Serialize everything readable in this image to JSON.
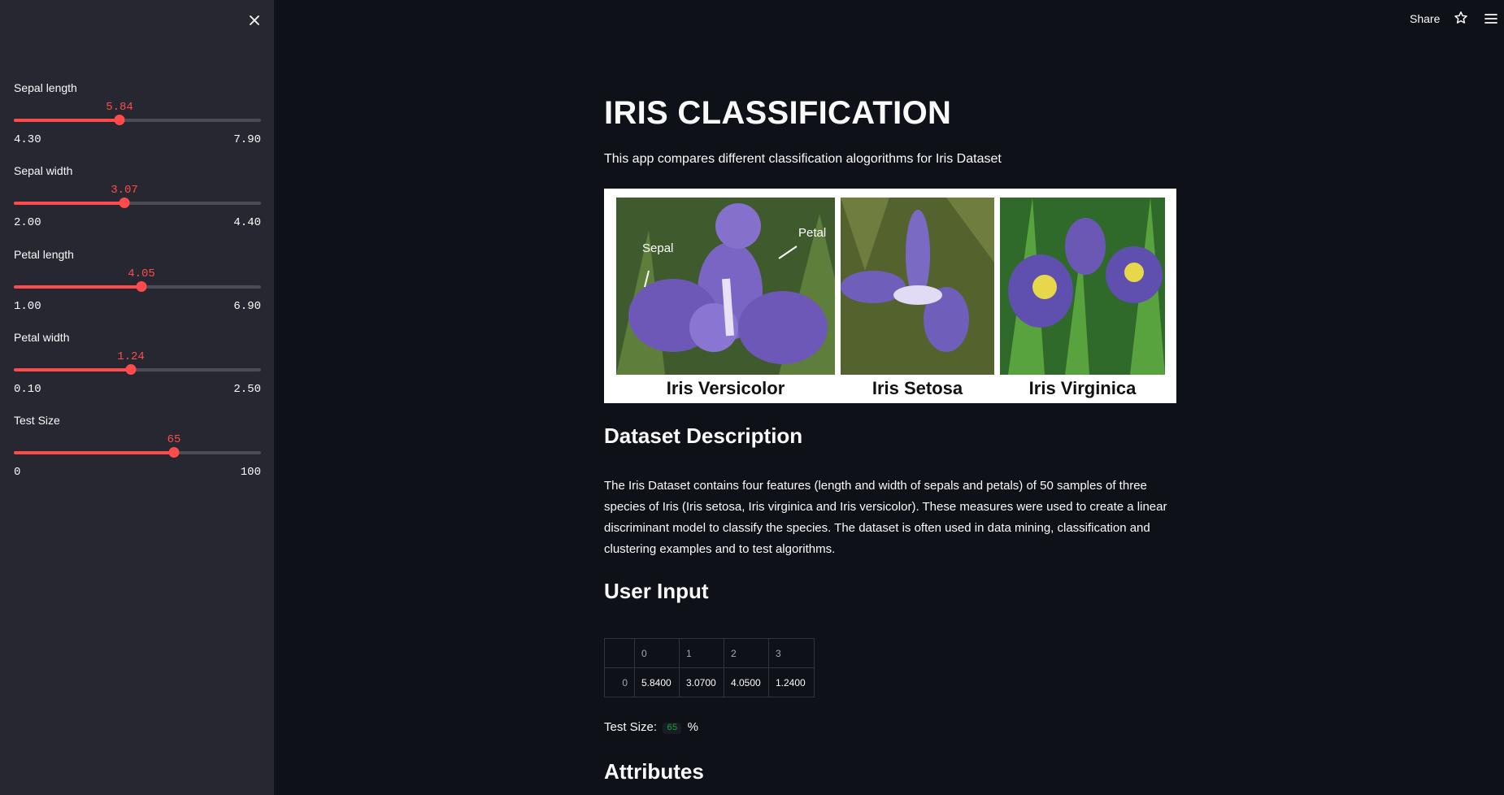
{
  "sidebar": {
    "sliders": [
      {
        "label": "Sepal length",
        "value": "5.84",
        "min": "4.30",
        "max": "7.90",
        "fraction": 0.428
      },
      {
        "label": "Sepal width",
        "value": "3.07",
        "min": "2.00",
        "max": "4.40",
        "fraction": 0.446
      },
      {
        "label": "Petal length",
        "value": "4.05",
        "min": "1.00",
        "max": "6.90",
        "fraction": 0.517
      },
      {
        "label": "Petal width",
        "value": "1.24",
        "min": "0.10",
        "max": "2.50",
        "fraction": 0.475
      },
      {
        "label": "Test Size",
        "value": "65",
        "min": "0",
        "max": "100",
        "fraction": 0.65
      }
    ],
    "accent_color": "#ff4b4b",
    "close_icon": "close-icon"
  },
  "header": {
    "share_label": "Share",
    "star_icon": "star-icon",
    "menu_icon": "hamburger-menu-icon"
  },
  "main": {
    "title": "IRIS CLASSIFICATION",
    "subtitle": "This app compares different classification alogorithms for Iris Dataset",
    "image": {
      "captions": [
        "Iris Versicolor",
        "Iris Setosa",
        "Iris Virginica"
      ],
      "annotations": [
        "Sepal",
        "Petal"
      ]
    },
    "dataset_heading": "Dataset Description",
    "dataset_text": "The Iris Dataset contains four features (length and width of sepals and petals) of 50 samples of three species of Iris (Iris setosa, Iris virginica and Iris versicolor). These measures were used to create a linear discriminant model to classify the species. The dataset is often used in data mining, classification and clustering examples and to test algorithms.",
    "user_input_heading": "User Input",
    "table": {
      "columns": [
        "0",
        "1",
        "2",
        "3"
      ],
      "rows": [
        {
          "index": "0",
          "cells": [
            "5.8400",
            "3.0700",
            "4.0500",
            "1.2400"
          ]
        }
      ]
    },
    "test_size": {
      "prefix": "Test Size:",
      "value": "65",
      "suffix": "%"
    },
    "attributes_heading": "Attributes"
  }
}
